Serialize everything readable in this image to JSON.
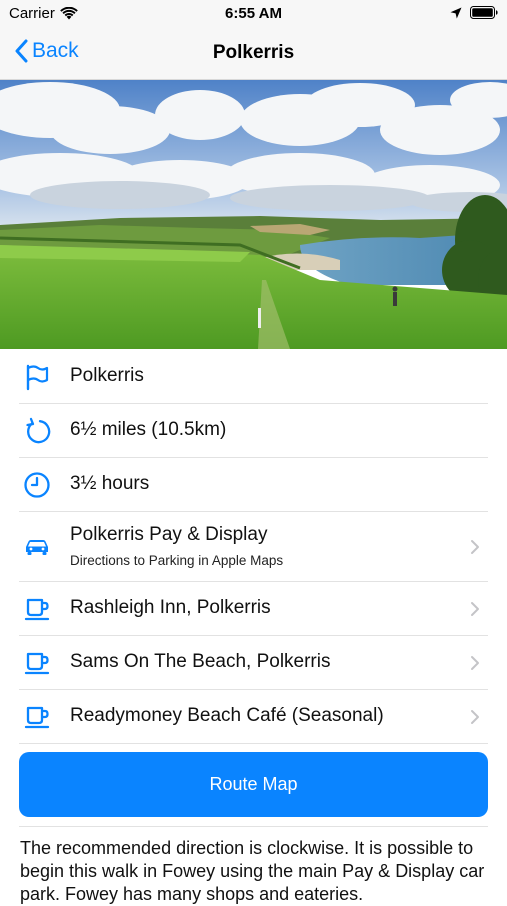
{
  "status_bar": {
    "carrier": "Carrier",
    "time": "6:55 AM"
  },
  "nav": {
    "back_label": "Back",
    "title": "Polkerris"
  },
  "details": [
    {
      "icon": "flag-icon",
      "label": "Polkerris"
    },
    {
      "icon": "circular-arrow-icon",
      "label": "6½ miles (10.5km)"
    },
    {
      "icon": "clock-icon",
      "label": "3½ hours"
    },
    {
      "icon": "car-icon",
      "label": "Polkerris Pay & Display",
      "subtitle": "Directions to Parking in Apple Maps"
    },
    {
      "icon": "coffee-cup-icon",
      "label": "Rashleigh Inn, Polkerris"
    },
    {
      "icon": "coffee-cup-icon",
      "label": "Sams On The Beach, Polkerris"
    },
    {
      "icon": "coffee-cup-icon",
      "label": "Readymoney Beach Café (Seasonal)"
    }
  ],
  "route_map_button": "Route Map",
  "description": "The recommended direction is clockwise. It is possible to begin this walk in Fowey using the main Pay & Display car park. Fowey has many shops and eateries.",
  "colors": {
    "accent": "#0a84ff",
    "nav_background": "#f7f7f7"
  }
}
